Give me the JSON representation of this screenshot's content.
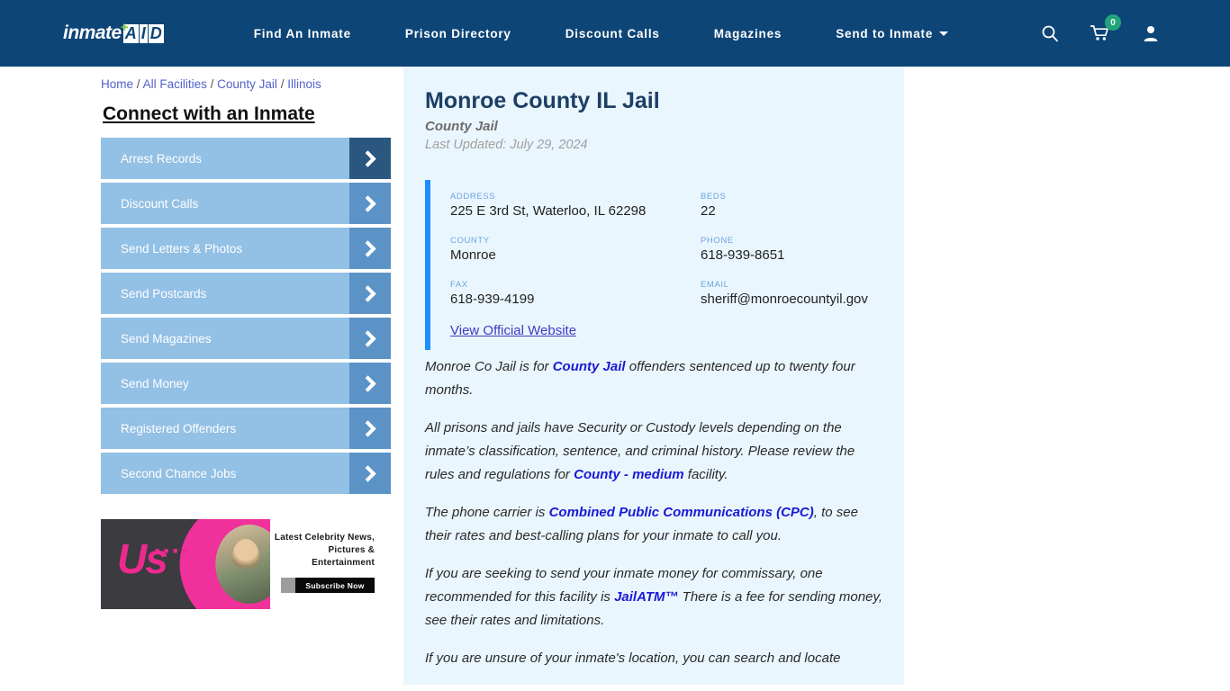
{
  "header": {
    "logo": {
      "word": "inmate",
      "plus": "+",
      "aid": [
        "A",
        "I",
        "D"
      ]
    },
    "nav": [
      {
        "label": "Find An Inmate",
        "dropdown": false
      },
      {
        "label": "Prison Directory",
        "dropdown": false
      },
      {
        "label": "Discount Calls",
        "dropdown": false
      },
      {
        "label": "Magazines",
        "dropdown": false
      },
      {
        "label": "Send to Inmate",
        "dropdown": true
      }
    ],
    "icons": {
      "search": "search-icon",
      "cart": "cart-icon",
      "cart_count": "0",
      "account": "user-icon"
    },
    "colors": {
      "bar": "#0d4577",
      "badge": "#22a47a",
      "logo_plus": "#7cc242"
    }
  },
  "breadcrumb": {
    "items": [
      "Home",
      "All Facilities",
      "County Jail",
      "Illinois"
    ],
    "separator": "/"
  },
  "sidebar": {
    "title": "Connect with an Inmate",
    "items": [
      {
        "label": "Arrest Records",
        "active": true
      },
      {
        "label": "Discount Calls",
        "active": false
      },
      {
        "label": "Send Letters & Photos",
        "active": false
      },
      {
        "label": "Send Postcards",
        "active": false
      },
      {
        "label": "Send Magazines",
        "active": false
      },
      {
        "label": "Send Money",
        "active": false
      },
      {
        "label": "Registered Offenders",
        "active": false
      },
      {
        "label": "Second Chance Jobs",
        "active": false
      }
    ],
    "colors": {
      "button": "#93c0e5",
      "arrow": "#5b93c7",
      "arrow_active": "#2b5680"
    }
  },
  "ad": {
    "brand": "Us",
    "dots": "■ ■ ■ ■",
    "headline": "Latest Celebrity News, Pictures & Entertainment",
    "cta": "Subscribe Now"
  },
  "facility": {
    "name": "Monroe County IL Jail",
    "type": "County Jail",
    "last_updated": "Last Updated: July 29, 2024",
    "info": [
      {
        "label": "ADDRESS",
        "value": "225 E 3rd St, Waterloo, IL 62298"
      },
      {
        "label": "BEDS",
        "value": "22"
      },
      {
        "label": "COUNTY",
        "value": "Monroe"
      },
      {
        "label": "PHONE",
        "value": "618-939-8651"
      },
      {
        "label": "FAX",
        "value": "618-939-4199"
      },
      {
        "label": "EMAIL",
        "value": "sheriff@monroecountyil.gov"
      }
    ],
    "official_website_label": "View Official Website",
    "accent_color": "#1e90ff",
    "card_bg": "#eaf6fd"
  },
  "article": {
    "paragraphs": [
      [
        {
          "t": "Monroe Co Jail is for ",
          "b": false
        },
        {
          "t": "County Jail",
          "b": true
        },
        {
          "t": " offenders sentenced up to twenty four months.",
          "b": false
        }
      ],
      [
        {
          "t": "All prisons and jails have Security or Custody levels depending on the inmate’s classification, sentence, and criminal history. Please review the rules and regulations for ",
          "b": false
        },
        {
          "t": "County - medium",
          "b": true
        },
        {
          "t": " facility.",
          "b": false
        }
      ],
      [
        {
          "t": "The phone carrier is ",
          "b": false
        },
        {
          "t": "Combined Public Communications (CPC)",
          "b": true
        },
        {
          "t": ", to see their rates and best-calling plans for your inmate to call you.",
          "b": false
        }
      ],
      [
        {
          "t": "If you are seeking to send your inmate money for commissary, one recommended for this facility is ",
          "b": false
        },
        {
          "t": "JailATM™",
          "b": true
        },
        {
          "t": " There is a fee for sending money, see their rates and limitations.",
          "b": false
        }
      ],
      [
        {
          "t": "If you are unsure of your inmate's location, you can search and locate",
          "b": false
        }
      ]
    ]
  }
}
